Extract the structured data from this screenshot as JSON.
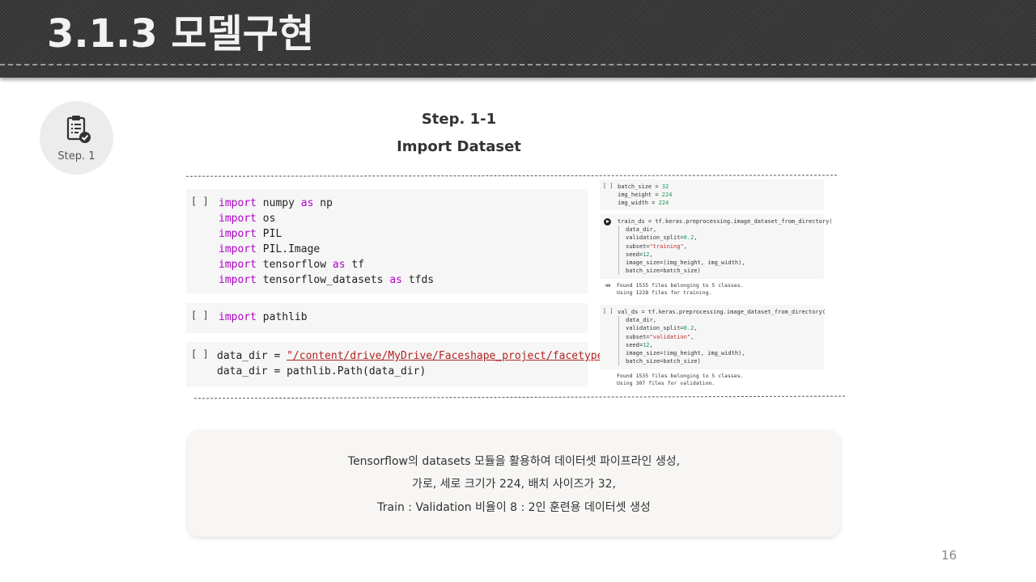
{
  "header": {
    "title": "3.1.3 모델구현"
  },
  "badge": {
    "icon": "clipboard-check-icon",
    "label": "Step. 1"
  },
  "step": {
    "number": "Step. 1-1",
    "subtitle": "Import Dataset"
  },
  "cell_bracket": "[ ]",
  "kw": {
    "import": "import",
    "as": "as"
  },
  "cell1": {
    "lines": [
      {
        "kw": "import",
        "mod": " numpy ",
        "as": "as",
        "alias": " np"
      },
      {
        "kw": "import",
        "mod": " os"
      },
      {
        "kw": "import",
        "mod": " PIL"
      },
      {
        "kw": "import",
        "mod": " PIL.Image"
      },
      {
        "kw": "import",
        "mod": " tensorflow ",
        "as": "as",
        "alias": " tf"
      },
      {
        "kw": "import",
        "mod": " tensorflow_datasets ",
        "as": "as",
        "alias": " tfds"
      }
    ]
  },
  "cell2": {
    "kw": "import",
    "mod": " pathlib"
  },
  "cell3": {
    "line1_prefix": "data_dir = ",
    "line1_string": "\"/content/drive/MyDrive/Faceshape_project/facetype\"",
    "line2": "data_dir = pathlib.Path(data_dir)"
  },
  "mini1": {
    "lines": [
      {
        "a": "batch_size = ",
        "n": "32"
      },
      {
        "a": "img_height = ",
        "n": "224"
      },
      {
        "a": "img_width = ",
        "n": "224"
      }
    ]
  },
  "mini2": {
    "head": "train_ds = tf.keras.preprocessing.image_dataset_from_directory(",
    "l1": "data_dir,",
    "l2a": "validation_split=",
    "l2n": "0.2",
    "l2b": ",",
    "l3a": "subset=",
    "l3s": "\"training\"",
    "l3b": ",",
    "l4a": "seed=",
    "l4n": "12",
    "l4b": ",",
    "l5": "image_size=(img_height, img_width),",
    "l6": "batch_size=batch_size)"
  },
  "out1": {
    "icon": "output-icon",
    "l1": "Found 1535 files belonging to 5 classes.",
    "l2": "Using 1228 files for training."
  },
  "mini3": {
    "head": "val_ds = tf.keras.preprocessing.image_dataset_from_directory(",
    "l1": "data_dir,",
    "l2a": "validation_split=",
    "l2n": "0.2",
    "l2b": ",",
    "l3a": "subset=",
    "l3s": "\"validation\"",
    "l3b": ",",
    "l4a": "seed=",
    "l4n": "12",
    "l4b": ",",
    "l5": "image_size=(img_height, img_width),",
    "l6": "batch_size=batch_size)"
  },
  "out2": {
    "l1": "Found 1535 files belonging to 5 classes.",
    "l2": "Using 307 files for validation."
  },
  "summary": {
    "line1": "Tensorflow의 datasets 모듈을 활용하여 데이터셋 파이프라인 생성,",
    "line2": "가로, 세로 크기가 224, 배치 사이즈가 32,",
    "line3": "Train : Validation 비율이 8 : 2인 훈련용 데이터셋 생성"
  },
  "page_number": "16"
}
